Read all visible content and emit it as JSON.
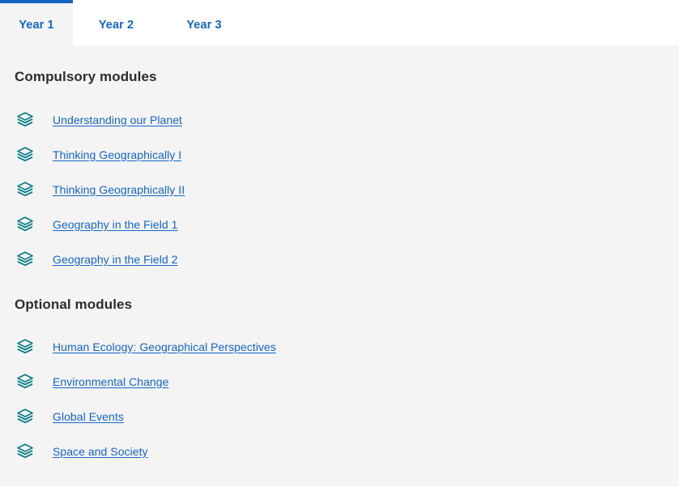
{
  "tabs": [
    {
      "label": "Year 1",
      "active": true
    },
    {
      "label": "Year 2",
      "active": false
    },
    {
      "label": "Year 3",
      "active": false
    }
  ],
  "colors": {
    "link": "#1565c8",
    "tab_active_border": "#1565c8",
    "icon": "#0e7f88",
    "panel_background": "#f4f4f4",
    "heading_text": "#2e2e2e"
  },
  "sections": [
    {
      "heading": "Compulsory modules",
      "icon_name": "layers-icon",
      "modules": [
        {
          "label": "Understanding our Planet"
        },
        {
          "label": "Thinking Geographically I"
        },
        {
          "label": "Thinking Geographically II"
        },
        {
          "label": "Geography in the Field 1"
        },
        {
          "label": "Geography in the Field 2"
        }
      ]
    },
    {
      "heading": "Optional modules",
      "icon_name": "layers-icon",
      "modules": [
        {
          "label": "Human Ecology: Geographical Perspectives"
        },
        {
          "label": "Environmental Change"
        },
        {
          "label": "Global Events"
        },
        {
          "label": "Space and Society"
        }
      ]
    }
  ]
}
